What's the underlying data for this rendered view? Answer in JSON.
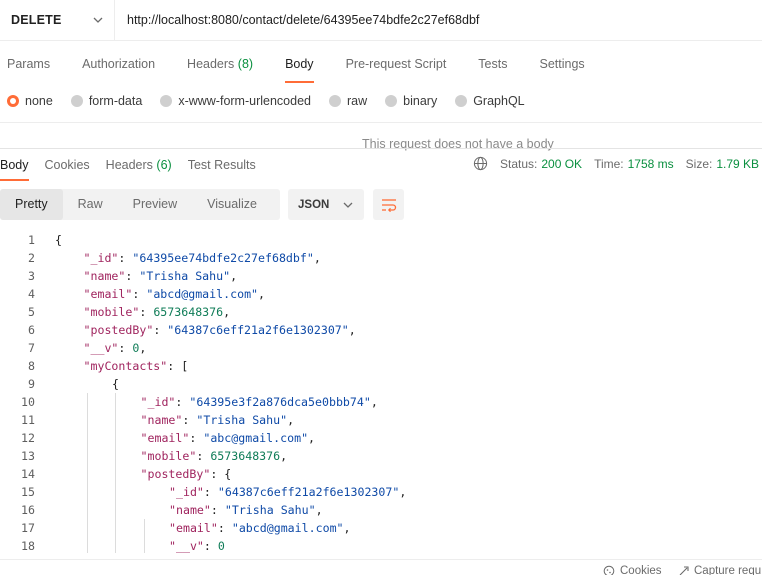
{
  "request": {
    "method": "DELETE",
    "url": "http://localhost:8080/contact/delete/64395ee74bdfe2c27ef68dbf"
  },
  "request_tabs": [
    {
      "label": "Params",
      "count": ""
    },
    {
      "label": "Authorization",
      "count": ""
    },
    {
      "label": "Headers",
      "count": "(8)"
    },
    {
      "label": "Body",
      "count": ""
    },
    {
      "label": "Pre-request Script",
      "count": ""
    },
    {
      "label": "Tests",
      "count": ""
    },
    {
      "label": "Settings",
      "count": ""
    }
  ],
  "body_types": [
    "none",
    "form-data",
    "x-www-form-urlencoded",
    "raw",
    "binary",
    "GraphQL"
  ],
  "no_body_message": "This request does not have a body",
  "response_tabs": [
    {
      "label": "Body",
      "count": ""
    },
    {
      "label": "Cookies",
      "count": ""
    },
    {
      "label": "Headers",
      "count": "(6)"
    },
    {
      "label": "Test Results",
      "count": ""
    }
  ],
  "response_meta": {
    "status_label": "Status:",
    "status_value": "200 OK",
    "time_label": "Time:",
    "time_value": "1758 ms",
    "size_label": "Size:",
    "size_value": "1.79 KB"
  },
  "view_modes": [
    "Pretty",
    "Raw",
    "Preview",
    "Visualize"
  ],
  "format": "JSON",
  "code_lines": [
    {
      "n": "1",
      "indent": 0,
      "parts": [
        [
          "p",
          "{"
        ]
      ]
    },
    {
      "n": "2",
      "indent": 1,
      "parts": [
        [
          "k2",
          "\"_id\""
        ],
        [
          "p",
          ": "
        ],
        [
          "s",
          "\"64395ee74bdfe2c27ef68dbf\""
        ],
        [
          "p",
          ","
        ]
      ]
    },
    {
      "n": "3",
      "indent": 1,
      "parts": [
        [
          "k2",
          "\"name\""
        ],
        [
          "p",
          ": "
        ],
        [
          "s",
          "\"Trisha Sahu\""
        ],
        [
          "p",
          ","
        ]
      ]
    },
    {
      "n": "4",
      "indent": 1,
      "parts": [
        [
          "k2",
          "\"email\""
        ],
        [
          "p",
          ": "
        ],
        [
          "s",
          "\"abcd@gmail.com\""
        ],
        [
          "p",
          ","
        ]
      ]
    },
    {
      "n": "5",
      "indent": 1,
      "parts": [
        [
          "k2",
          "\"mobile\""
        ],
        [
          "p",
          ": "
        ],
        [
          "n",
          "6573648376"
        ],
        [
          "p",
          ","
        ]
      ]
    },
    {
      "n": "6",
      "indent": 1,
      "parts": [
        [
          "k2",
          "\"postedBy\""
        ],
        [
          "p",
          ": "
        ],
        [
          "s",
          "\"64387c6eff21a2f6e1302307\""
        ],
        [
          "p",
          ","
        ]
      ]
    },
    {
      "n": "7",
      "indent": 1,
      "parts": [
        [
          "k2",
          "\"__v\""
        ],
        [
          "p",
          ": "
        ],
        [
          "n",
          "0"
        ],
        [
          "p",
          ","
        ]
      ]
    },
    {
      "n": "8",
      "indent": 1,
      "parts": [
        [
          "k2",
          "\"myContacts\""
        ],
        [
          "p",
          ": ["
        ]
      ]
    },
    {
      "n": "9",
      "indent": 2,
      "parts": [
        [
          "p",
          "{"
        ]
      ]
    },
    {
      "n": "10",
      "indent": 3,
      "parts": [
        [
          "k2",
          "\"_id\""
        ],
        [
          "p",
          ": "
        ],
        [
          "s",
          "\"64395e3f2a876dca5e0bbb74\""
        ],
        [
          "p",
          ","
        ]
      ]
    },
    {
      "n": "11",
      "indent": 3,
      "parts": [
        [
          "k2",
          "\"name\""
        ],
        [
          "p",
          ": "
        ],
        [
          "s",
          "\"Trisha Sahu\""
        ],
        [
          "p",
          ","
        ]
      ]
    },
    {
      "n": "12",
      "indent": 3,
      "parts": [
        [
          "k2",
          "\"email\""
        ],
        [
          "p",
          ": "
        ],
        [
          "s",
          "\"abc@gmail.com\""
        ],
        [
          "p",
          ","
        ]
      ]
    },
    {
      "n": "13",
      "indent": 3,
      "parts": [
        [
          "k2",
          "\"mobile\""
        ],
        [
          "p",
          ": "
        ],
        [
          "n",
          "6573648376"
        ],
        [
          "p",
          ","
        ]
      ]
    },
    {
      "n": "14",
      "indent": 3,
      "parts": [
        [
          "k2",
          "\"postedBy\""
        ],
        [
          "p",
          ": {"
        ]
      ]
    },
    {
      "n": "15",
      "indent": 4,
      "parts": [
        [
          "k2",
          "\"_id\""
        ],
        [
          "p",
          ": "
        ],
        [
          "s",
          "\"64387c6eff21a2f6e1302307\""
        ],
        [
          "p",
          ","
        ]
      ]
    },
    {
      "n": "16",
      "indent": 4,
      "parts": [
        [
          "k2",
          "\"name\""
        ],
        [
          "p",
          ": "
        ],
        [
          "s",
          "\"Trisha Sahu\""
        ],
        [
          "p",
          ","
        ]
      ]
    },
    {
      "n": "17",
      "indent": 4,
      "parts": [
        [
          "k2",
          "\"email\""
        ],
        [
          "p",
          ": "
        ],
        [
          "s",
          "\"abcd@gmail.com\""
        ],
        [
          "p",
          ","
        ]
      ]
    },
    {
      "n": "18",
      "indent": 4,
      "parts": [
        [
          "k2",
          "\"__v\""
        ],
        [
          "p",
          ": "
        ],
        [
          "n",
          "0"
        ]
      ]
    }
  ],
  "footer": {
    "cookies": "Cookies",
    "capture": "Capture requ"
  }
}
